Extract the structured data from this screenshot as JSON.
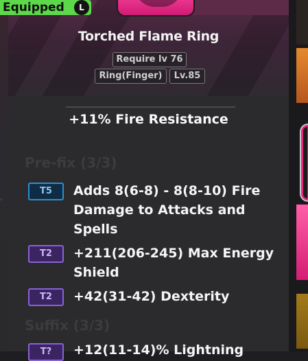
{
  "badge": {
    "label": "Equipped",
    "key": "L"
  },
  "item": {
    "name": "Torched Flame Ring",
    "require": "Require lv 76",
    "type": "Ring(Finger)",
    "level": "Lv.85",
    "implicit": "+11% Fire Resistance"
  },
  "sections": {
    "prefix": "Pre-fix (3/3)",
    "suffix": "Suffix (3/3)"
  },
  "prefix_mods": [
    {
      "tier": "T5",
      "tier_color": "blue",
      "text": "Adds 8(6-8) - 8(8-10) Fire Damage to Attacks and Spells"
    },
    {
      "tier": "T2",
      "tier_color": "purple",
      "text": "+211(206-245) Max Energy Shield"
    },
    {
      "tier": "T2",
      "tier_color": "purple",
      "text": "+42(31-42) Dexterity"
    }
  ],
  "suffix_mods": [
    {
      "tier": "T?",
      "tier_color": "purple",
      "text": "+12(11-14)% Lightning"
    }
  ],
  "colors": {
    "equipped_green": "#5cd84a",
    "tier_blue": "#2d8fd1",
    "tier_purple": "#8a61d8",
    "item_pink": "#ff4fa3"
  }
}
